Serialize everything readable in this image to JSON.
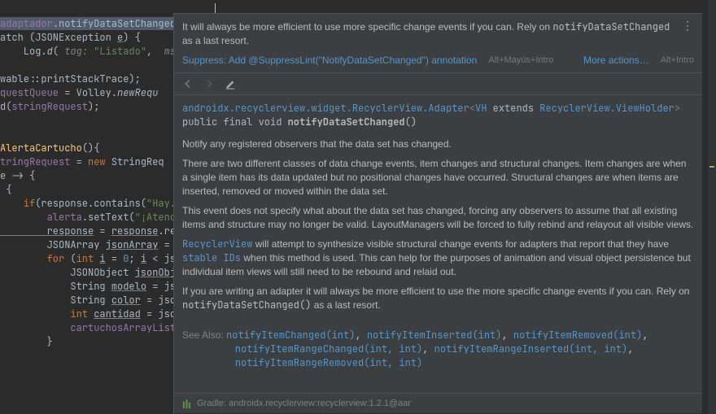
{
  "code": {
    "l1a": "adaptador",
    "l1b": ".notifyDataSetChanged();",
    "l2a": "atch (JSONException ",
    "l2b": "e",
    "l2c": ") {",
    "l3a": "    Log.",
    "l3b": "d",
    "l3c": "(",
    "l3t": " tag: ",
    "l3d": "\"Listado\"",
    "l3e": ", ",
    "l3m": " msg:",
    "l4": "",
    "l5": "wable::printStackTrace);",
    "l6a": "questQueue",
    "l6b": " = Volley.",
    "l6c": "newRequ",
    "l7a": "d(",
    "l7b": "stringRequest",
    "l7c": ");",
    "l8": "",
    "l9": "",
    "l10a": "AlertaCartucho",
    "l10b": "(){",
    "l11a": "tringRequest",
    "l11b": " = ",
    "l11c": "new",
    "l11d": " StringReq",
    "l12": "e -> {",
    "l13": " {",
    "l14a": "    if",
    "l14b": "(response.contains(",
    "l14c": "\"Hay.",
    "l15a": "        alerta",
    "l15b": ".setText(",
    "l15c": "\"¡Atenc",
    "l16a": "        response",
    "l16b": " = ",
    "l16c": "response",
    "l16d": ".re",
    "l17a": "        JSONArray ",
    "l17b": "jsonArray",
    "l17c": " = ",
    "l18a": "        for ",
    "l18b": "(",
    "l18c": "int ",
    "l18d": "i",
    "l18e": " = ",
    "l18f": "0",
    "l18g": "; ",
    "l18h": "i",
    "l18i": " < js",
    "l19a": "            JSONObject ",
    "l19b": "jsonObj",
    "l20a": "            String ",
    "l20b": "modelo",
    "l20c": " = js",
    "l21a": "            String ",
    "l21b": "color",
    "l21c": " = jso",
    "l22a": "            int ",
    "l22b": "cantidad",
    "l22c": " = jso",
    "l23a": "            cartuchosArrayList",
    "l24": "        }"
  },
  "popup": {
    "inspection_msg_a": "It will always be more efficient to use more specific change events if you can. Rely on ",
    "inspection_msg_code": "notifyDataSetChanged",
    "inspection_msg_b": " as a last resort.",
    "quickfix_label": "Suppress: Add @SuppressLint(\"NotifyDataSetChanged\") annotation",
    "quickfix_shortcut": "Alt+Mayús+Intro",
    "more_actions": "More actions…",
    "more_shortcut": "Alt+Intro",
    "sig_pkg": "androidx.recyclerview.widget",
    "sig_class": "RecyclerView.Adapter",
    "sig_generic_a": "VH",
    "sig_extends": " extends ",
    "sig_generic_b": "RecyclerView.ViewHolder",
    "sig_mods": "public final void ",
    "sig_name": "notifyDataSetChanged",
    "sig_parens": "()",
    "p1": "Notify any registered observers that the data set has changed.",
    "p2": "There are two different classes of data change events, item changes and structural changes. Item changes are when a single item has its data updated but no positional changes have occurred. Structural changes are when items are inserted, removed or moved within the data set.",
    "p3": "This event does not specify what about the data set has changed, forcing any observers to assume that all existing items and structure may no longer be valid. LayoutManagers will be forced to fully rebind and relayout all visible views.",
    "p4a": "RecyclerView",
    "p4b": " will attempt to synthesize visible structural change events for adapters that report that they have ",
    "p4c": "stable IDs",
    "p4d": " when this method is used. This can help for the purposes of animation and visual object persistence but individual item views will still need to be rebound and relaid out.",
    "p5a": "If you are writing an adapter it will always be more efficient to use the more specific change events if you can. Rely on ",
    "p5b": "notifyDataSetChanged()",
    "p5c": " as a last resort.",
    "see_label": "See Also:",
    "see1": "notifyItemChanged(int)",
    "see2": "notifyItemInserted(int)",
    "see3": "notifyItemRemoved(int)",
    "see4": "notifyItemRangeChanged(int, int)",
    "see5": "notifyItemRangeInserted(int, int)",
    "see6": "notifyItemRangeRemoved(int, int)",
    "comma": ", ",
    "footer": "Gradle: androidx.recyclerview:recyclerview:1.2.1@aar"
  }
}
